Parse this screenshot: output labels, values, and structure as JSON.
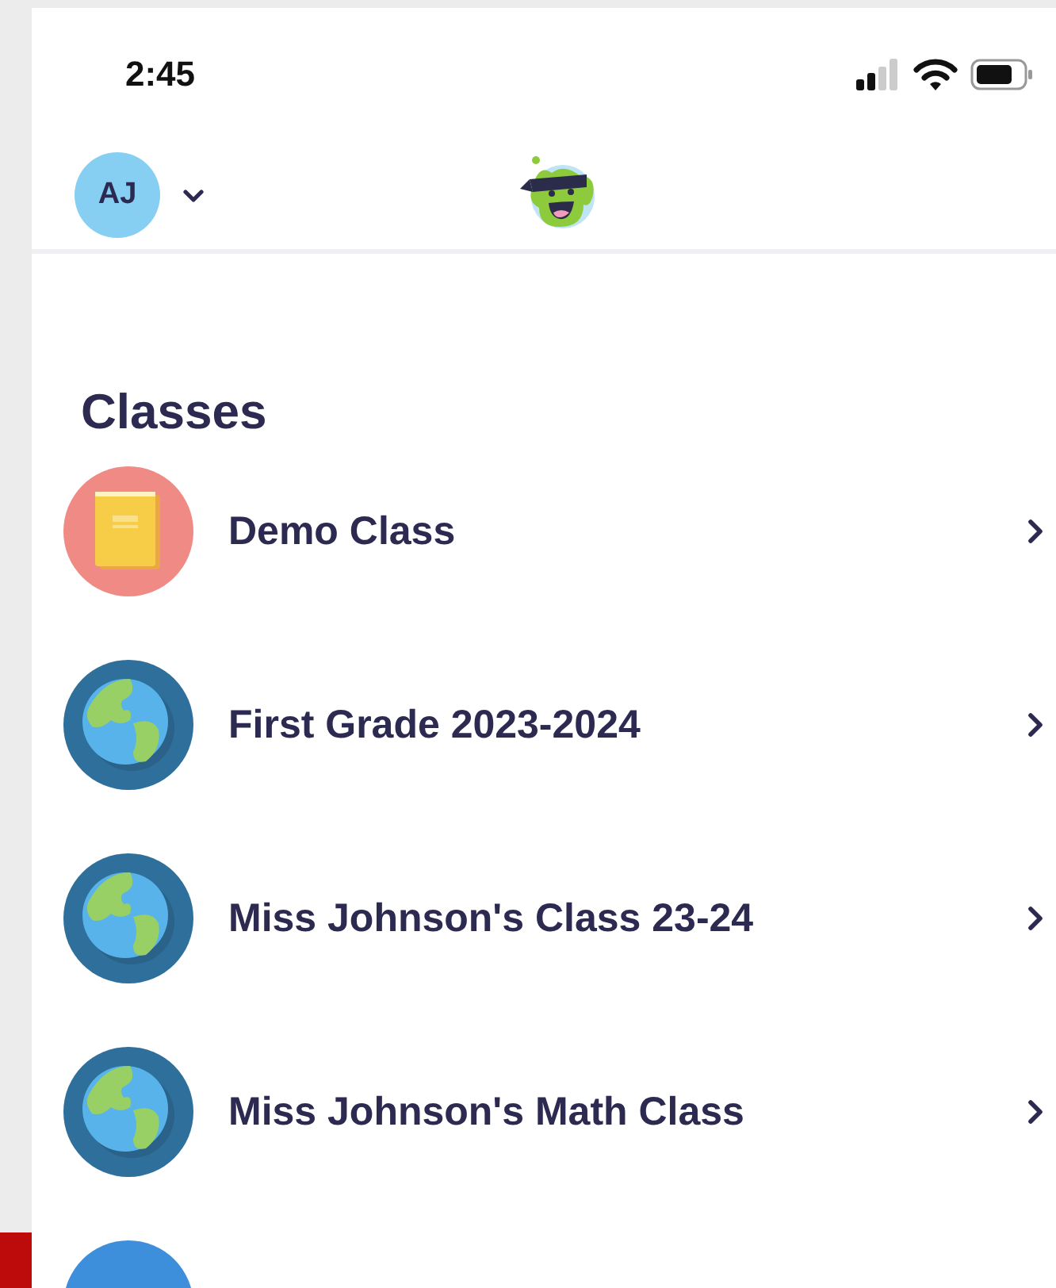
{
  "status_bar": {
    "time": "2:45"
  },
  "header": {
    "avatar_initials": "AJ"
  },
  "section_title": "Classes",
  "classes": [
    {
      "name": "Demo Class",
      "kind": "book"
    },
    {
      "name": "First Grade 2023-2024",
      "kind": "globe"
    },
    {
      "name": "Miss Johnson's Class 23-24",
      "kind": "globe"
    },
    {
      "name": "Miss Johnson's Math Class",
      "kind": "globe"
    }
  ]
}
